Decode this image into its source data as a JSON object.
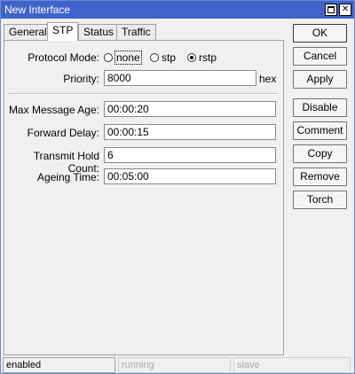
{
  "window": {
    "title": "New Interface",
    "restore_glyph": "",
    "close_glyph": "✕"
  },
  "tabs": [
    {
      "label": "General"
    },
    {
      "label": "STP",
      "active": true
    },
    {
      "label": "Status"
    },
    {
      "label": "Traffic"
    }
  ],
  "form": {
    "protocol_mode": {
      "label": "Protocol Mode:",
      "options": [
        "none",
        "stp",
        "rstp"
      ],
      "selected": "rstp"
    },
    "priority": {
      "label": "Priority:",
      "value": "8000",
      "unit": "hex"
    },
    "max_message_age": {
      "label": "Max Message Age:",
      "value": "00:00:20"
    },
    "forward_delay": {
      "label": "Forward Delay:",
      "value": "00:00:15"
    },
    "transmit_hold_count": {
      "label": "Transmit Hold Count:",
      "value": "6"
    },
    "ageing_time": {
      "label": "Ageing Time:",
      "value": "00:05:00"
    }
  },
  "buttons": {
    "ok": "OK",
    "cancel": "Cancel",
    "apply": "Apply",
    "disable": "Disable",
    "comment": "Comment",
    "copy": "Copy",
    "remove": "Remove",
    "torch": "Torch"
  },
  "status": {
    "state": "enabled",
    "running": "running",
    "slave": "slave"
  }
}
